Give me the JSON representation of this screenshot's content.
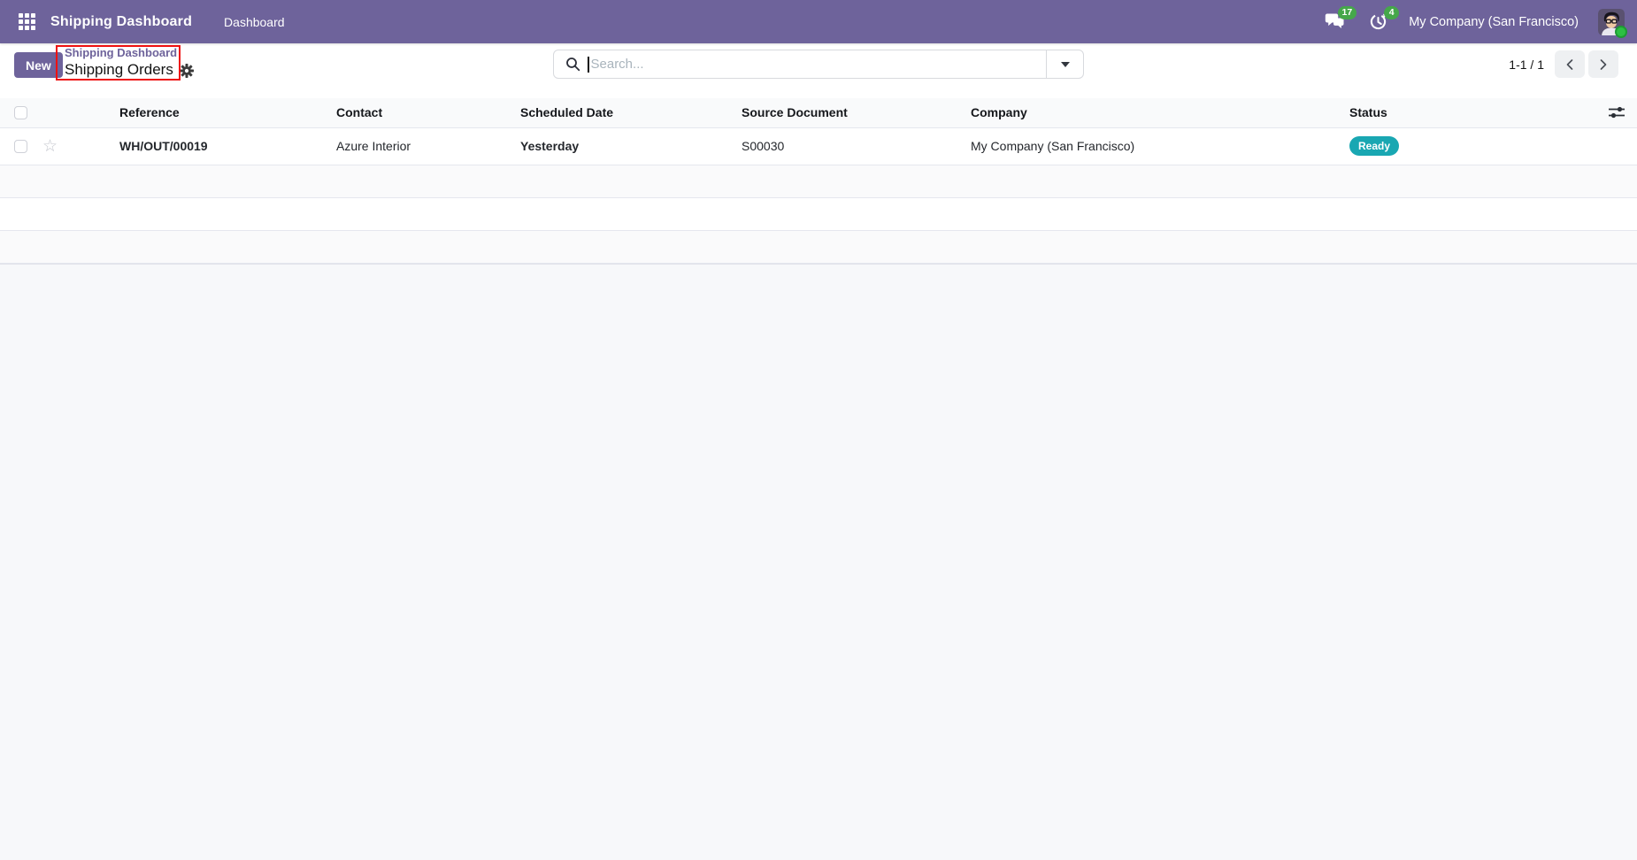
{
  "topbar": {
    "app_title": "Shipping Dashboard",
    "menu_dashboard": "Dashboard",
    "messages_badge": "17",
    "activities_badge": "4",
    "company": "My Company (San Francisco)"
  },
  "control_panel": {
    "new_button": "New",
    "breadcrumb_parent": "Shipping Dashboard",
    "breadcrumb_current": "Shipping Orders",
    "search": {
      "placeholder": "Search..."
    },
    "pager": {
      "range": "1-1 / 1"
    }
  },
  "table": {
    "columns": [
      "Reference",
      "Contact",
      "Scheduled Date",
      "Source Document",
      "Company",
      "Status"
    ],
    "rows": [
      {
        "reference": "WH/OUT/00019",
        "contact": "Azure Interior",
        "scheduled_date": "Yesterday",
        "source_document": "S00030",
        "company": "My Company (San Francisco)",
        "status": "Ready"
      }
    ]
  },
  "colors": {
    "topbar_purple": "#6e639b",
    "badge_green": "#45a74a",
    "status_ready_teal": "#19a7b2",
    "scheduled_late_red": "#dc4036",
    "annotation_red": "#ee1111"
  }
}
